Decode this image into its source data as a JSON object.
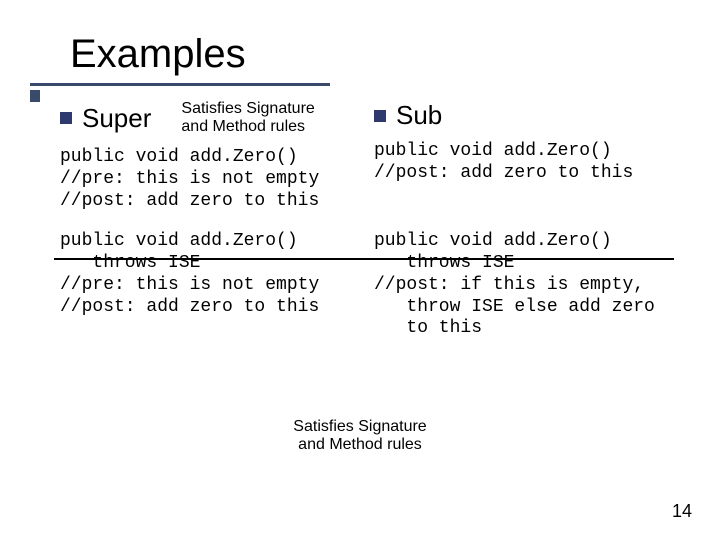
{
  "title": "Examples",
  "left": {
    "heading": "Super",
    "note_line1": "Satisfies Signature",
    "note_line2": "and Method rules",
    "code1": "public void add.Zero()\n//pre: this is not empty\n//post: add zero to this",
    "code2": "public void add.Zero()\n   throws ISE\n//pre: this is not empty\n//post: add zero to this"
  },
  "right": {
    "heading": "Sub",
    "code1": "public void add.Zero()\n//post: add zero to this",
    "code2": "public void add.Zero()\n   throws ISE\n//post: if this is empty,\n   throw ISE else add zero\n   to this"
  },
  "bottom_note_line1": "Satisfies Signature",
  "bottom_note_line2": "and Method rules",
  "page_number": "14"
}
